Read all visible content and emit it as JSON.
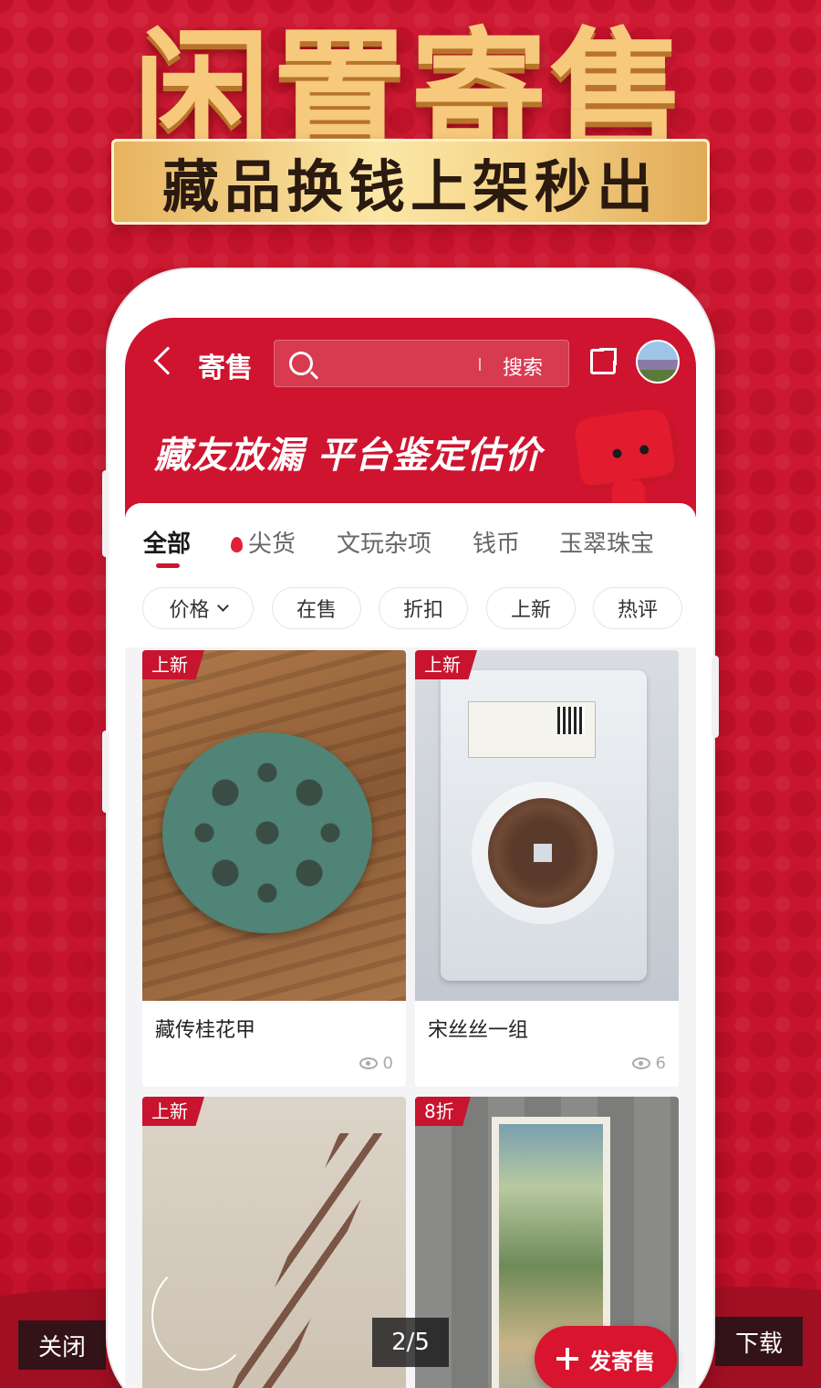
{
  "hero": {
    "title": "闲置寄售",
    "banner": "藏品换钱上架秒出"
  },
  "app": {
    "nav_title": "寄售",
    "search_placeholder": "",
    "search_button": "搜索",
    "promo": "藏友放漏  平台鉴定估价"
  },
  "tabs": [
    {
      "label": "全部",
      "active": true
    },
    {
      "label": "尖货",
      "icon": "fire-icon"
    },
    {
      "label": "文玩杂项"
    },
    {
      "label": "钱币"
    },
    {
      "label": "玉翠珠宝"
    }
  ],
  "filters": [
    {
      "label": "价格",
      "icon": "chevron-down-icon"
    },
    {
      "label": "在售"
    },
    {
      "label": "折扣"
    },
    {
      "label": "上新"
    },
    {
      "label": "热评"
    }
  ],
  "products": [
    {
      "tag": "上新",
      "title": "藏传桂花甲",
      "views": "0"
    },
    {
      "tag": "上新",
      "title": "宋丝丝一组",
      "views": "6"
    },
    {
      "tag": "上新",
      "title": "",
      "views": ""
    },
    {
      "tag": "8折",
      "title": "",
      "views": ""
    }
  ],
  "fab_label": "发寄售",
  "viewer": {
    "close": "关闭",
    "page": "2/5",
    "download": "下载"
  },
  "colors": {
    "brand_red": "#cf1430",
    "gold": "#f6c97c"
  }
}
